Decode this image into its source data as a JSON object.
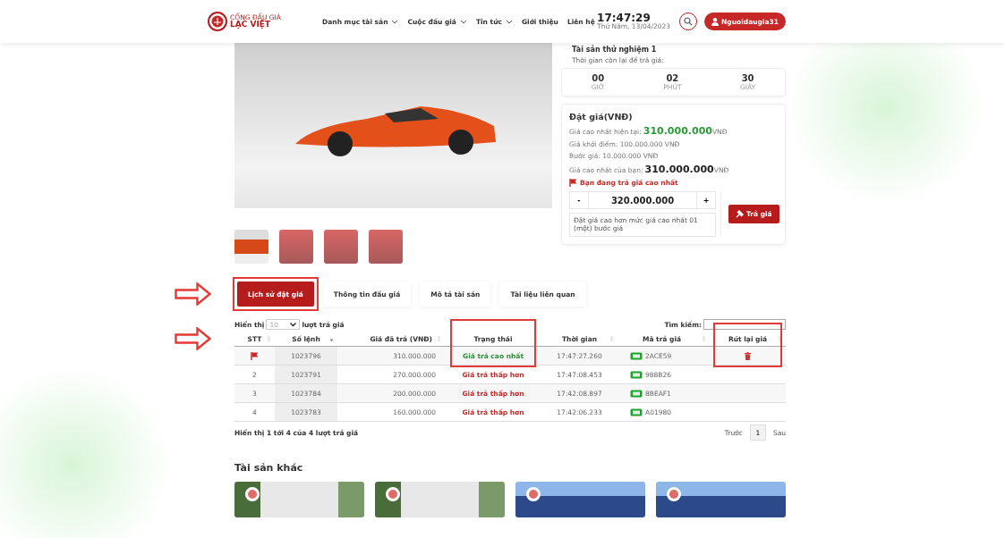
{
  "header": {
    "logo": {
      "top": "CỔNG ĐẤU GIÁ",
      "bottom": "LẠC VIỆT"
    },
    "nav": [
      {
        "label": "Danh mục tài sản",
        "dropdown": true
      },
      {
        "label": "Cuộc đấu giá",
        "dropdown": true
      },
      {
        "label": "Tin tức",
        "dropdown": true
      },
      {
        "label": "Giới thiệu",
        "dropdown": false
      },
      {
        "label": "Liên hệ",
        "dropdown": false
      }
    ],
    "clock": {
      "time": "17:47:29",
      "date": "Thứ Năm, 13/04/2023"
    },
    "user": "Nguoidaugia31"
  },
  "asset": {
    "title": "Tài sản thử nghiệm 1",
    "thumbnails": [
      {
        "selected": true
      },
      {
        "selected": false
      },
      {
        "selected": false
      },
      {
        "selected": false
      }
    ]
  },
  "countdown": {
    "label": "Thời gian còn lại để trả giá:",
    "units": [
      {
        "value": "00",
        "unit": "GIỜ"
      },
      {
        "value": "02",
        "unit": "PHÚT"
      },
      {
        "value": "30",
        "unit": "GIÂY"
      }
    ]
  },
  "bid": {
    "title": "Đặt giá(VNĐ)",
    "lines": [
      {
        "kind": "highlight",
        "label": "Giá cao nhất hiện tại: ",
        "amount": "310.000.000",
        "unit": " VNĐ"
      },
      {
        "kind": "plain",
        "label": "Giá khởi điểm: 100.000.000 VNĐ"
      },
      {
        "kind": "plain",
        "label": "Bước giá: 10.000.000 VNĐ"
      },
      {
        "kind": "strong",
        "label": "Giá cao nhất của bạn: ",
        "amount": "310.000.000",
        "unit": " VNĐ"
      }
    ],
    "notice": "Bạn đang trả giá cao nhất",
    "minus": "-",
    "value": "320.000.000",
    "plus": "+",
    "hint": "Đặt giá cao hơn mức giá cao nhất 01 (một) bước giá",
    "submit": "Trả giá"
  },
  "tabs": [
    {
      "label": "Lịch sử đặt giá",
      "selected": true
    },
    {
      "label": "Thông tin đấu giá",
      "selected": false
    },
    {
      "label": "Mô tả tài sản",
      "selected": false
    },
    {
      "label": "Tài liệu liên quan",
      "selected": false
    }
  ],
  "table": {
    "show_label": "Hiển thị",
    "page_size": "10",
    "show_suffix": "lượt trả giá",
    "search_label": "Tìm kiếm:",
    "columns": [
      "STT",
      "Số lệnh",
      "Giá đã trả (VNĐ)",
      "Trạng thái",
      "Thời gian",
      "Mã trả giá",
      "Rút lại giá"
    ],
    "rows": [
      {
        "stt": "",
        "flag": true,
        "order": "1023796",
        "price": "310.000.000",
        "status": "Giá trả cao nhất",
        "kind": "highest",
        "time": "17:47:27.260",
        "code": "2ACE59",
        "withdraw": true
      },
      {
        "stt": "2",
        "flag": false,
        "order": "1023791",
        "price": "270.000.000",
        "status": "Giá trả thấp hơn",
        "kind": "lower",
        "time": "17:47:08.453",
        "code": "988B26",
        "withdraw": false
      },
      {
        "stt": "3",
        "flag": false,
        "order": "1023784",
        "price": "200.000.000",
        "status": "Giá trả thấp hơn",
        "kind": "lower",
        "time": "17:42:08.897",
        "code": "8BEAF1",
        "withdraw": false
      },
      {
        "stt": "4",
        "flag": false,
        "order": "1023783",
        "price": "160.000.000",
        "status": "Giá trả thấp hơn",
        "kind": "lower",
        "time": "17:42:06.233",
        "code": "A01980",
        "withdraw": false
      }
    ],
    "info": "Hiển thị 1 tới 4 của 4 lượt trả giá",
    "prev": "Trước",
    "pages": [
      {
        "label": "1",
        "selected": true
      }
    ],
    "next": "Sau"
  },
  "other": {
    "title": "Tài sản khác",
    "cards": [
      {
        "kind": "statue"
      },
      {
        "kind": "statue"
      },
      {
        "kind": "building"
      },
      {
        "kind": "building"
      }
    ]
  }
}
